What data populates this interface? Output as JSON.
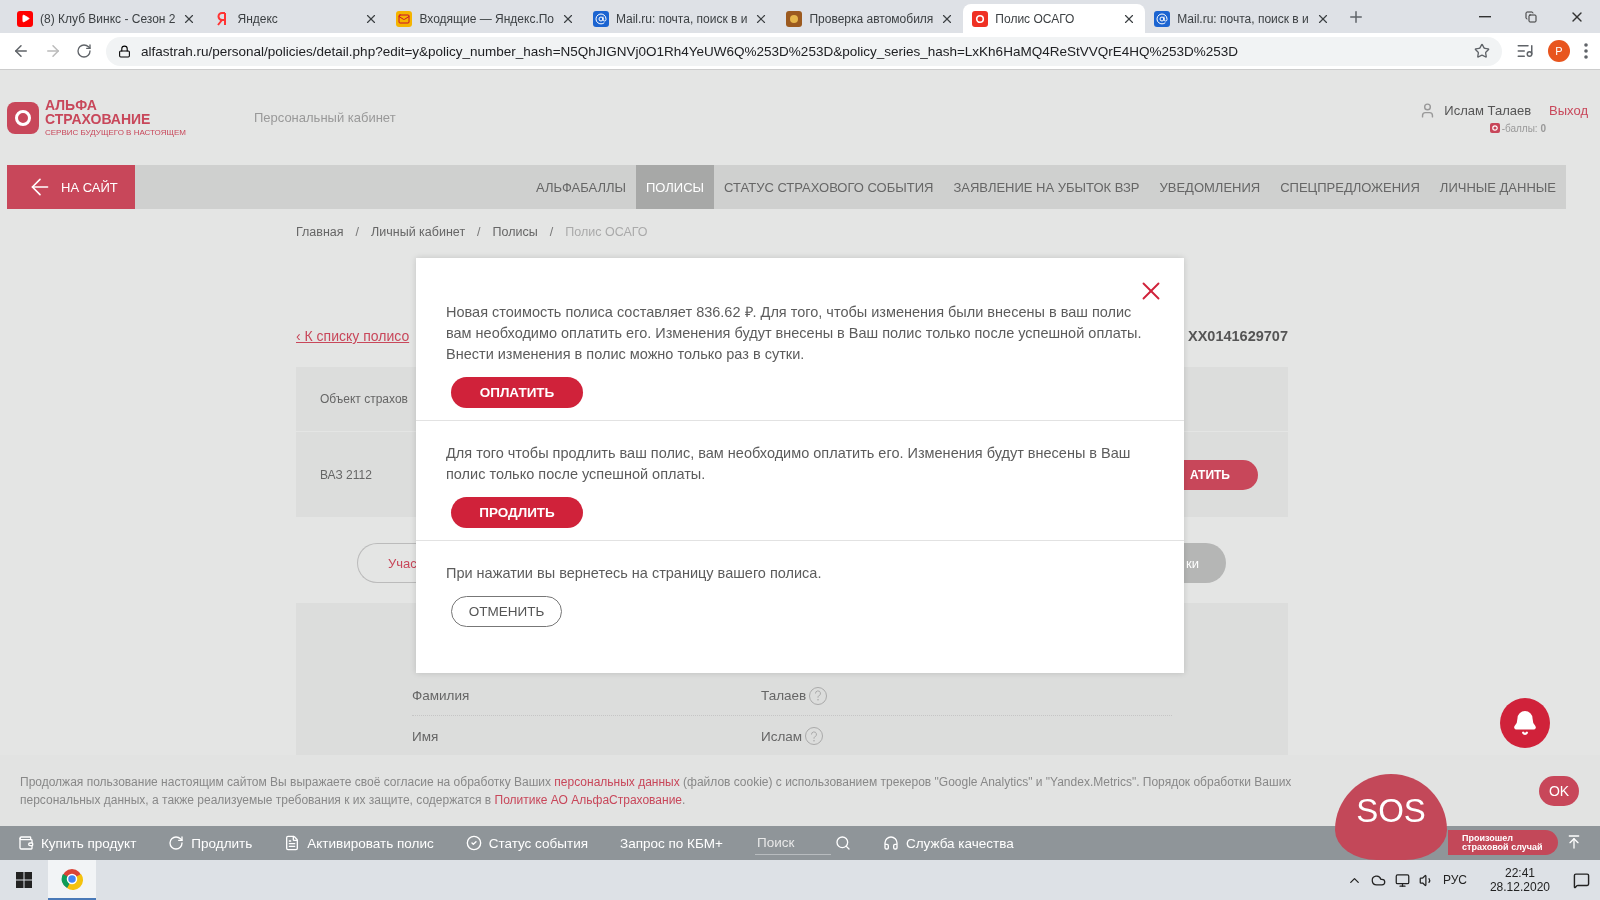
{
  "browser": {
    "tabs": [
      {
        "kind": "video",
        "title": "(8) Клуб Винкс - Сезон 2",
        "selected": false
      },
      {
        "kind": "letter",
        "title": "Яндекс",
        "selected": false
      },
      {
        "kind": "mail",
        "title": "Входящие — Яндекс.По",
        "selected": false
      },
      {
        "kind": "at",
        "title": "Mail.ru: почта, поиск в и",
        "selected": false
      },
      {
        "kind": "badge",
        "title": "Проверка автомобиля",
        "selected": false
      },
      {
        "kind": "logo",
        "title": "Полис ОСАГО",
        "selected": true
      },
      {
        "kind": "at",
        "title": "Mail.ru: почта, поиск в и",
        "selected": false
      }
    ],
    "url": "alfastrah.ru/personal/policies/detail.php?edit=y&policy_number_hash=N5QhJIGNVj0O1Rh4YeUW6Q%253D%253D&policy_series_hash=LxKh6HaMQ4ReStVVQrE4HQ%253D%253D",
    "profile": "Р"
  },
  "header": {
    "logo_lines": [
      "АЛЬФА",
      "СТРАХОВАНИЕ"
    ],
    "logo_tagline": "СЕРВИС БУДУЩЕГО В НАСТОЯЩЕМ",
    "section": "Персональный кабинет",
    "user": "Ислам Талаев",
    "logout": "Выход",
    "points": "-баллы: **0**"
  },
  "nav": {
    "back": "НА САЙТ",
    "items": [
      {
        "label": "АЛЬФАБАЛЛЫ",
        "selected": false
      },
      {
        "label": "ПОЛИСЫ",
        "selected": true
      },
      {
        "label": "СТАТУС СТРАХОВОГО СОБЫТИЯ",
        "selected": false
      },
      {
        "label": "ЗАЯВЛЕНИЕ НА УБЫТОК ВЗР",
        "selected": false
      },
      {
        "label": "УВЕДОМЛЕНИЯ",
        "selected": false
      },
      {
        "label": "СПЕЦПРЕДЛОЖЕНИЯ",
        "selected": false
      },
      {
        "label": "ЛИЧНЫЕ ДАННЫЕ",
        "selected": false
      }
    ]
  },
  "breadcrumbs": [
    {
      "label": "Главная"
    },
    {
      "separator": "/",
      "label": "Личный кабинет"
    },
    {
      "separator": "/",
      "label": "Полисы"
    },
    {
      "separator": "/",
      "label": "Полис ОСАГО"
    }
  ],
  "back_link": "‹ К списку полисо",
  "policy_number": "ХХ0141629707",
  "object_card": {
    "header": "Объект страхов",
    "vehicle": "ВАЗ 2112",
    "button": "АТИТЬ"
  },
  "pills": {
    "left": "Учас",
    "right": "ки"
  },
  "person": {
    "rows": [
      {
        "label": "Фамилия",
        "value": "Талаев"
      },
      {
        "label": "Имя",
        "value": "Ислам"
      }
    ]
  },
  "modal": {
    "sections": [
      {
        "text": "Новая стоимость полиса составляет 836.62 ₽. Для того, чтобы изменения были внесены в ваш полис вам необходимо оплатить его. Изменения будут внесены в Ваш полис только после успешной оплаты. Внести изменения в полис можно только раз в сутки.",
        "button": "ОПЛАТИТЬ",
        "kind": "primary"
      },
      {
        "text": "Для того чтобы продлить ваш полис, вам необходимо оплатить его. Изменения будут внесены в Ваш полис только после успешной оплаты.",
        "button": "ПРОДЛИТЬ",
        "kind": "primary"
      },
      {
        "text": "При нажатии вы вернетесь на страницу вашего полиса.",
        "button": "ОТМЕНИТЬ",
        "kind": "outline"
      }
    ]
  },
  "cookie": {
    "parts": [
      {
        "kind": "text",
        "text": "Продолжая пользование настоящим сайтом Вы выражаете своё согласие на обработку Ваших "
      },
      {
        "kind": "link",
        "text": "персональных данных"
      },
      {
        "kind": "text",
        "text": " (файлов cookie) с использованием трекеров \"Google Analytics\" и \"Yandex.Metrics\". Порядок обработки Ваших персональных данных, а также реализуемые требования к их защите, содержатся в "
      },
      {
        "kind": "link",
        "text": "Политике АО АльфаСтрахование"
      },
      {
        "kind": "text",
        "text": "."
      }
    ],
    "ok": "OK"
  },
  "bottom_bar": {
    "items": [
      {
        "kind": "wallet",
        "label": "Купить продукт"
      },
      {
        "kind": "renew",
        "label": "Продлить"
      },
      {
        "kind": "document",
        "label": "Активировать полис"
      },
      {
        "kind": "check",
        "label": "Статус события"
      },
      {
        "kind": "plain",
        "label": "Запрос по КБМ+"
      }
    ],
    "search_placeholder": "Поиск",
    "quality": "Служба качества",
    "sos": "SOS",
    "incident": [
      "Произошел",
      "страховой случай"
    ]
  },
  "taskbar": {
    "language": "РУС",
    "time": "22:41",
    "date": "28.12.2020"
  }
}
